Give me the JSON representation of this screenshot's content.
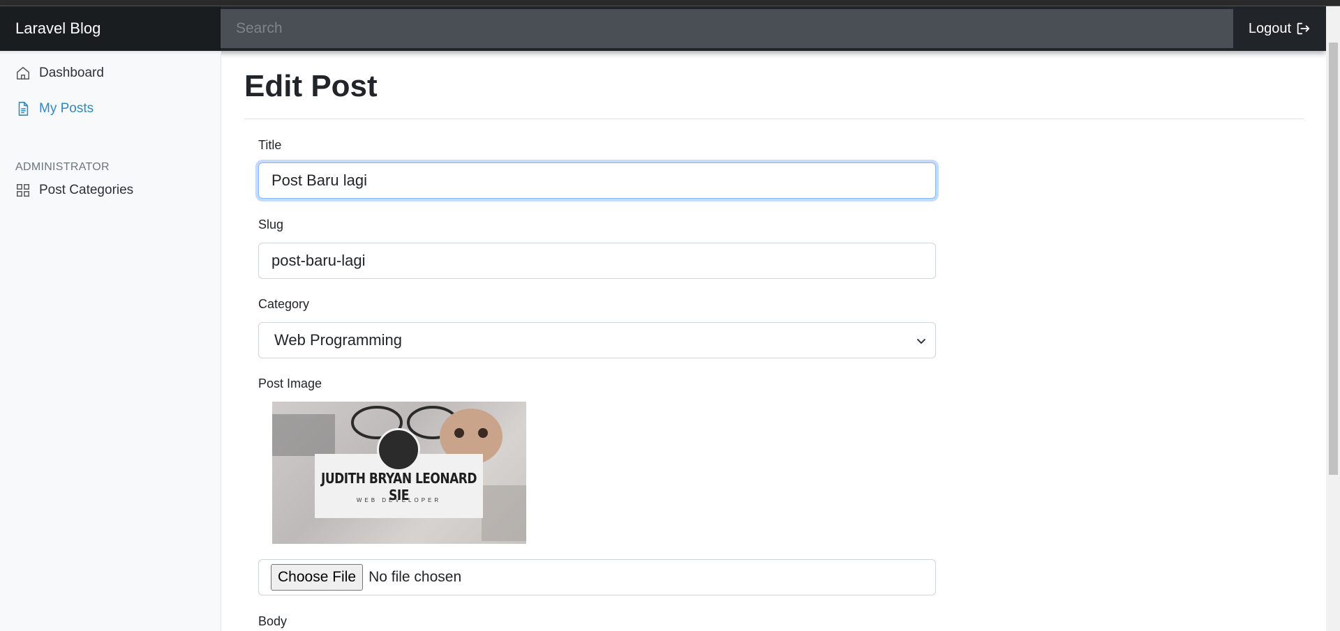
{
  "navbar": {
    "brand": "Laravel Blog",
    "search_placeholder": "Search",
    "logout_label": "Logout"
  },
  "sidebar": {
    "items": [
      {
        "label": "Dashboard",
        "icon": "home-icon",
        "active": false
      },
      {
        "label": "My Posts",
        "icon": "file-text-icon",
        "active": true
      }
    ],
    "admin_heading": "ADMINISTRATOR",
    "admin_items": [
      {
        "label": "Post Categories",
        "icon": "grid-icon",
        "active": false
      }
    ]
  },
  "page": {
    "title": "Edit Post"
  },
  "form": {
    "title_label": "Title",
    "title_value": "Post Baru lagi",
    "slug_label": "Slug",
    "slug_value": "post-baru-lagi",
    "category_label": "Category",
    "category_value": "Web Programming",
    "image_label": "Post Image",
    "image_caption_name": "JUDITH BRYAN LEONARD SIE",
    "image_caption_role": "WEB DEVELOPER",
    "file_button_label": "Choose File",
    "file_status": "No file chosen",
    "body_label": "Body"
  },
  "colors": {
    "navbar_bg": "#212529",
    "active_link": "#2b8ac4",
    "sidebar_bg": "#f8f9fa"
  }
}
